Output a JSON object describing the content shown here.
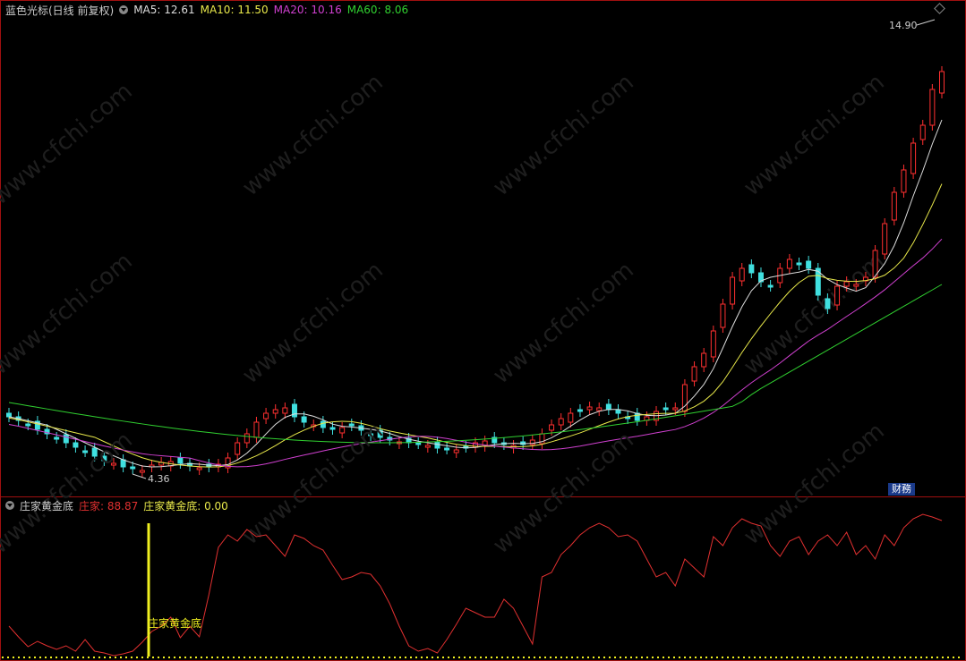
{
  "main_panel": {
    "indicator_name": "蓝色光标(日线 前复权)",
    "ma": [
      {
        "label": "MA5: ",
        "value": "12.61",
        "color": "#dddddd"
      },
      {
        "label": "MA10: ",
        "value": "11.50",
        "color": "#e8e84a"
      },
      {
        "label": "MA20: ",
        "value": "10.16",
        "color": "#d040d0"
      },
      {
        "label": "MA60: ",
        "value": "8.06",
        "color": "#30d030"
      }
    ],
    "high_marker": "14.90",
    "low_marker": "4.36",
    "watermark": "www.cfchi.com",
    "finance_badge": "财務"
  },
  "sub_panel": {
    "indicator_name": "庄家黄金底",
    "series": [
      {
        "label": "庄家: ",
        "value": "88.87",
        "color": "#e03030"
      },
      {
        "label": "庄家黄金底: ",
        "value": "0.00",
        "color": "#e8e84a"
      }
    ],
    "signal_label": "庄家黄金底"
  },
  "colors": {
    "up": "#ff3030",
    "down": "#40e0e0",
    "ma5": "#dddddd",
    "ma10": "#e8e84a",
    "ma20": "#d040d0",
    "ma60": "#30d030",
    "sub_line": "#e03030",
    "signal": "#f0f020"
  }
}
